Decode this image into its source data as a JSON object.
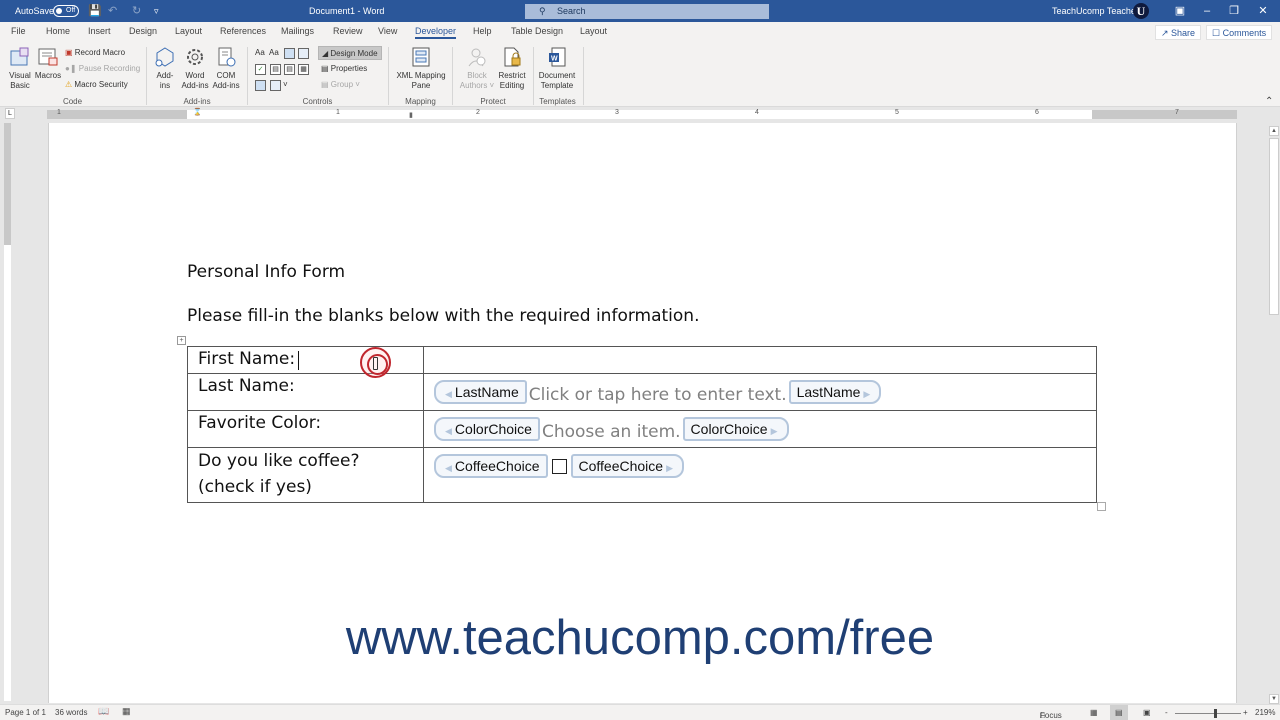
{
  "titlebar": {
    "autosave_label": "AutoSave",
    "autosave_state": "Off",
    "doc_title": "Document1 - Word",
    "search_placeholder": "Search",
    "user_name": "TeachUcomp Teacher",
    "avatar_letter": "U"
  },
  "tabs": [
    {
      "label": "File"
    },
    {
      "label": "Home"
    },
    {
      "label": "Insert"
    },
    {
      "label": "Design"
    },
    {
      "label": "Layout"
    },
    {
      "label": "References"
    },
    {
      "label": "Mailings"
    },
    {
      "label": "Review"
    },
    {
      "label": "View"
    },
    {
      "label": "Developer",
      "active": true
    },
    {
      "label": "Help"
    },
    {
      "label": "Table Design"
    },
    {
      "label": "Layout"
    }
  ],
  "share_label": "Share",
  "comments_label": "Comments",
  "ribbon": {
    "code": {
      "label": "Code",
      "visual_basic": "Visual Basic",
      "visual_basic_1": "Visual",
      "visual_basic_2": "Basic",
      "macros": "Macros",
      "record_macro": "Record Macro",
      "pause_recording": "Pause Recording",
      "macro_security": "Macro Security"
    },
    "addins": {
      "label": "Add-ins",
      "addins_1": "Add-",
      "addins_2": "ins",
      "word_addins_1": "Word",
      "word_addins_2": "Add-ins",
      "com_addins_1": "COM",
      "com_addins_2": "Add-ins"
    },
    "controls": {
      "label": "Controls",
      "design_mode": "Design Mode",
      "properties": "Properties",
      "group": "Group"
    },
    "mapping": {
      "label": "Mapping",
      "xml_1": "XML Mapping",
      "xml_2": "Pane"
    },
    "protect": {
      "label": "Protect",
      "block_1": "Block",
      "block_2": "Authors",
      "restrict_1": "Restrict",
      "restrict_2": "Editing"
    },
    "templates": {
      "label": "Templates",
      "doc_1": "Document",
      "doc_2": "Template"
    }
  },
  "ruler": {
    "numbers": [
      "1",
      "1",
      "2",
      "3",
      "4",
      "5",
      "6",
      "7"
    ]
  },
  "document": {
    "title": "Personal Info Form",
    "instructions": "Please fill-in the blanks below with the required information.",
    "table": {
      "rows": [
        {
          "label": "First Name:"
        },
        {
          "label": "Last Name:",
          "tag": "LastName",
          "placeholder": "Click or tap here to enter text."
        },
        {
          "label": "Favorite Color:",
          "tag": "ColorChoice",
          "placeholder": "Choose an item."
        },
        {
          "label_1": "Do you like coffee?",
          "label_2": "(check if yes)",
          "tag": "CoffeeChoice",
          "checked": false
        }
      ]
    }
  },
  "watermark": "www.teachucomp.com/free",
  "statusbar": {
    "page": "Page 1 of 1",
    "words": "36 words",
    "focus": "Focus",
    "zoom_level": "219%",
    "zoom_minus": "-",
    "zoom_plus": "+"
  }
}
